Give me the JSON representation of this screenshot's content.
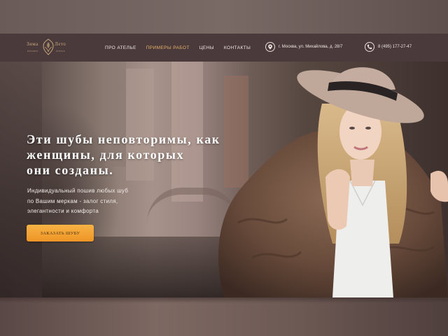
{
  "logo": {
    "word_left": "Зима",
    "word_right": "Лето",
    "sub_left": "меховое",
    "sub_right": "ателье"
  },
  "nav": {
    "items": [
      {
        "label": "Про ателье",
        "active": false
      },
      {
        "label": "Примеры работ",
        "active": true
      },
      {
        "label": "Цены",
        "active": false
      },
      {
        "label": "Контакты",
        "active": false
      }
    ]
  },
  "contacts": {
    "address": "г. Москва, ул. Михайлова, д. 28/7",
    "address_icon": "map-pin-icon",
    "phone": "8 (495) 177-27-47",
    "phone_icon": "phone-icon"
  },
  "hero": {
    "title_lines": [
      "Эти шубы неповторимы, как",
      "женщины, для которых",
      "они созданы."
    ],
    "subtitle_lines": [
      "Индивидуальный пошив любых шуб",
      "по Вашим меркам - залог стиля,",
      "элегантности и комфорта"
    ],
    "cta_label": "Заказать шубу"
  },
  "colors": {
    "header_bg": "#4a3a3b",
    "accent": "#e8b36b",
    "cta": "#f2a33a"
  }
}
